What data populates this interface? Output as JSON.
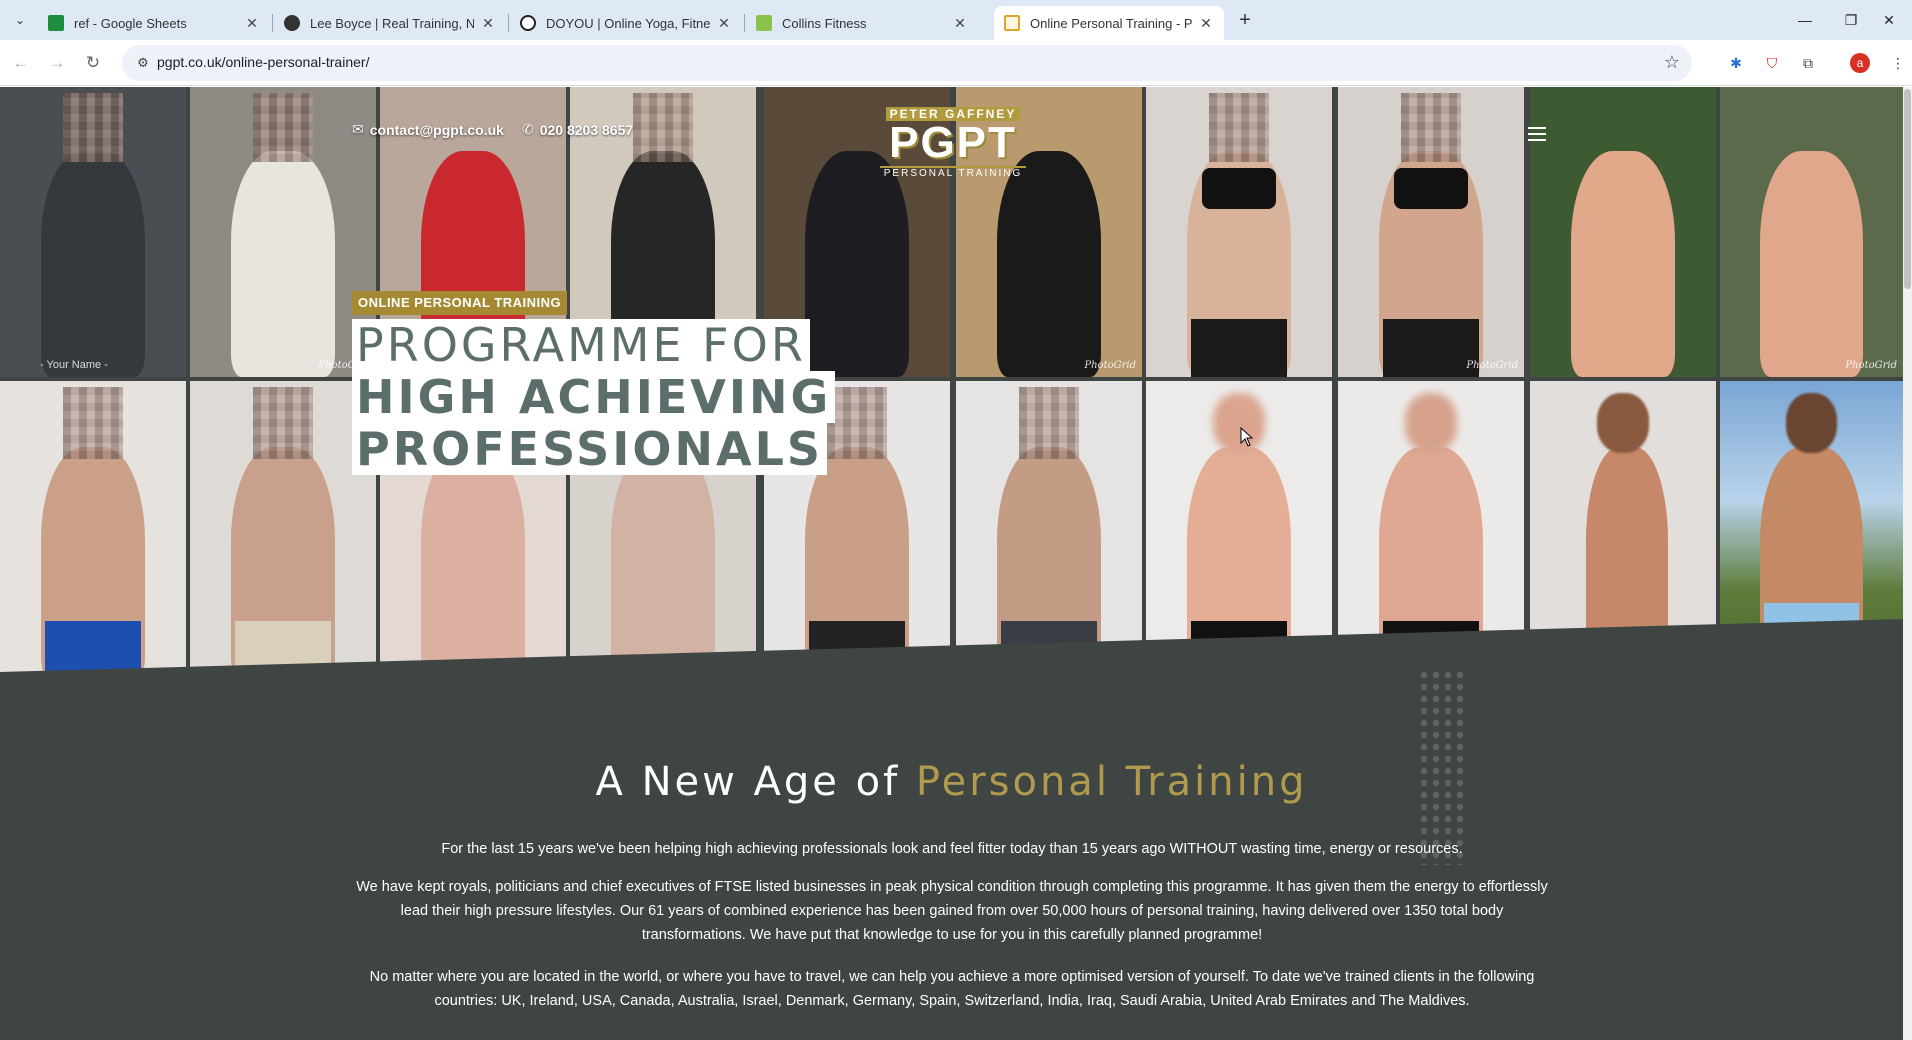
{
  "browser": {
    "tabs": [
      {
        "title": "ref - Google Sheets",
        "favicon": "google-sheets-icon",
        "color": "#1e8e3e"
      },
      {
        "title": "Lee Boyce | Real Training, No N",
        "favicon": "person-silhouette-icon",
        "color": "#333333"
      },
      {
        "title": "DOYOU | Online Yoga, Fitness, &",
        "favicon": "doyou-circle-icon",
        "color": "#222222"
      },
      {
        "title": "Collins Fitness",
        "favicon": "green-square-icon",
        "color": "#8bc34a"
      },
      {
        "title": "Online Personal Training - PGPT",
        "favicon": "document-icon",
        "color": "#e0a526"
      }
    ],
    "url": "pgpt.co.uk/online-personal-trainer/"
  },
  "site": {
    "email": "contact@pgpt.co.uk",
    "phone": "020 8203 8657",
    "logo": {
      "top": "PETER GAFFNEY",
      "main": "PGPT",
      "bottom": "PERSONAL TRAINING"
    },
    "brand_gold": "#a58a33"
  },
  "hero": {
    "tagline": "ONLINE PERSONAL TRAINING",
    "headline_1": "PROGRAMME FOR",
    "headline_2": "HIGH ACHIEVING",
    "headline_3": "PROFESSIONALS",
    "watermark": "PhotoGrid",
    "your_name": "- Your Name -"
  },
  "intro": {
    "title_plain": "A New Age of",
    "title_accent": "Personal Training",
    "p1": "For the last 15 years we've been helping high achieving professionals look and feel fitter today than 15 years ago WITHOUT wasting time, energy or resources.",
    "p2": "We have kept royals, politicians and chief executives of FTSE listed businesses in peak physical condition through completing this programme. It has given them the energy to effortlessly lead their high pressure lifestyles. Our 61 years of combined experience has been gained from over 50,000 hours of personal training, having delivered over 1350 total body transformations. We have put that knowledge to use for you in this carefully planned programme!",
    "p3": "No matter where you are located in the world, or where you have to travel, we can help you achieve a more optimised version of yourself. To date we've trained clients in the following countries: UK, Ireland, USA, Canada, Australia, Israel, Denmark, Germany, Spain, Switzerland, India, Iraq, Saudi Arabia, United Arab Emirates and The Maldives."
  }
}
